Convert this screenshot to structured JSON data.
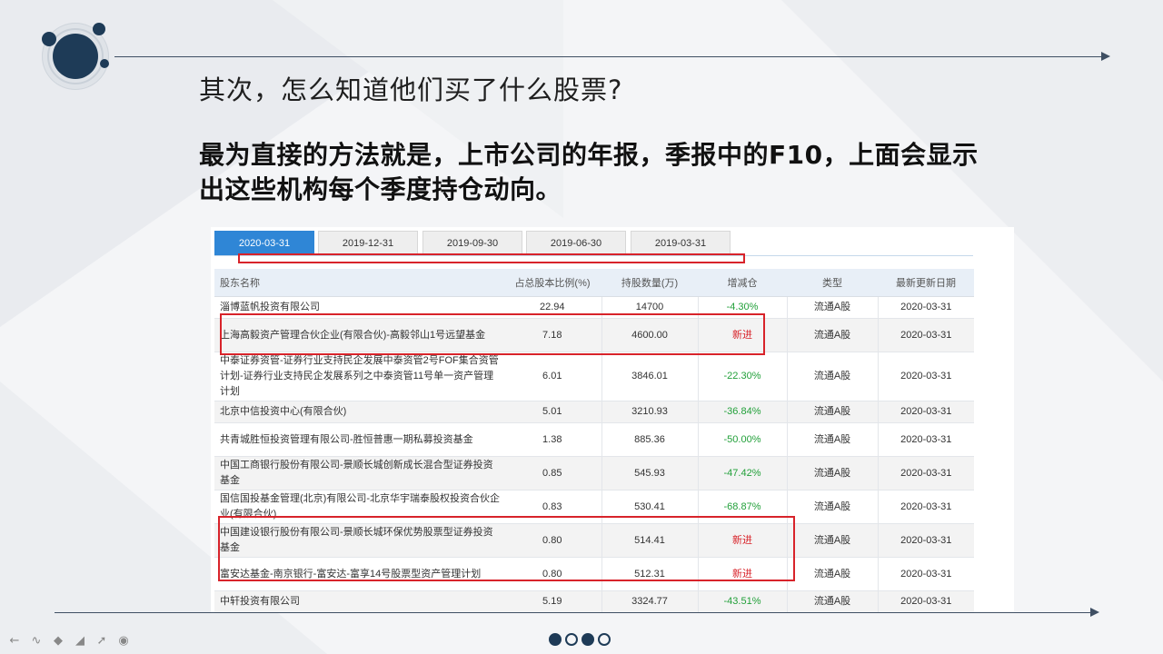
{
  "slide": {
    "heading": "其次，怎么知道他们买了什么股票?",
    "body_line1": "最为直接的方法就是，上市公司的年报，季报中的F10，上面会显示",
    "body_line2": "出这些机构每个季度持仓动向。"
  },
  "tabs": [
    {
      "label": "2020-03-31",
      "active": true
    },
    {
      "label": "2019-12-31",
      "active": false
    },
    {
      "label": "2019-09-30",
      "active": false
    },
    {
      "label": "2019-06-30",
      "active": false
    },
    {
      "label": "2019-03-31",
      "active": false
    }
  ],
  "table": {
    "headers": [
      "股东名称",
      "占总股本比例(%)",
      "持股数量(万)",
      "增减仓",
      "类型",
      "最新更新日期"
    ],
    "rows": [
      {
        "name": "淄博蓝帆投资有限公司",
        "ratio": "22.94",
        "shares": "14700",
        "change": "-4.30%",
        "type": "流通A股",
        "date": "2020-03-31"
      },
      {
        "name": "上海高毅资产管理合伙企业(有限合伙)-高毅邻山1号远望基金",
        "ratio": "7.18",
        "shares": "4600.00",
        "change": "新进",
        "type": "流通A股",
        "date": "2020-03-31"
      },
      {
        "name": "中泰证券资管-证券行业支持民企发展中泰资管2号FOF集合资管计划-证券行业支持民企发展系列之中泰资管11号单一资产管理计划",
        "ratio": "6.01",
        "shares": "3846.01",
        "change": "-22.30%",
        "type": "流通A股",
        "date": "2020-03-31"
      },
      {
        "name": "北京中信投资中心(有限合伙)",
        "ratio": "5.01",
        "shares": "3210.93",
        "change": "-36.84%",
        "type": "流通A股",
        "date": "2020-03-31"
      },
      {
        "name": "共青城胜恒投资管理有限公司-胜恒普惠一期私募投资基金",
        "ratio": "1.38",
        "shares": "885.36",
        "change": "-50.00%",
        "type": "流通A股",
        "date": "2020-03-31"
      },
      {
        "name": "中国工商银行股份有限公司-景顺长城创新成长混合型证券投资基金",
        "ratio": "0.85",
        "shares": "545.93",
        "change": "-47.42%",
        "type": "流通A股",
        "date": "2020-03-31"
      },
      {
        "name": "国信国投基金管理(北京)有限公司-北京华宇瑞泰股权投资合伙企业(有限合伙)",
        "ratio": "0.83",
        "shares": "530.41",
        "change": "-68.87%",
        "type": "流通A股",
        "date": "2020-03-31"
      },
      {
        "name": "中国建设银行股份有限公司-景顺长城环保优势股票型证券投资基金",
        "ratio": "0.80",
        "shares": "514.41",
        "change": "新进",
        "type": "流通A股",
        "date": "2020-03-31"
      },
      {
        "name": "富安达基金-南京银行-富安达-富享14号股票型资产管理计划",
        "ratio": "0.80",
        "shares": "512.31",
        "change": "新进",
        "type": "流通A股",
        "date": "2020-03-31"
      },
      {
        "name": "中轩投资有限公司",
        "ratio": "5.19",
        "shares": "3324.77",
        "change": "-43.51%",
        "type": "流通A股",
        "date": "2020-03-31"
      }
    ]
  },
  "toolbar": {
    "icons": [
      "arrow-left-icon",
      "pen-icon",
      "highlighter-icon",
      "eraser-icon",
      "pointer-icon",
      "record-icon"
    ]
  },
  "pager": {
    "dots": [
      true,
      false,
      true,
      false
    ]
  },
  "colors": {
    "accent": "#2f86d6",
    "navy": "#1e3b57",
    "highlight": "#d8232a",
    "negative": "#22a03a"
  }
}
